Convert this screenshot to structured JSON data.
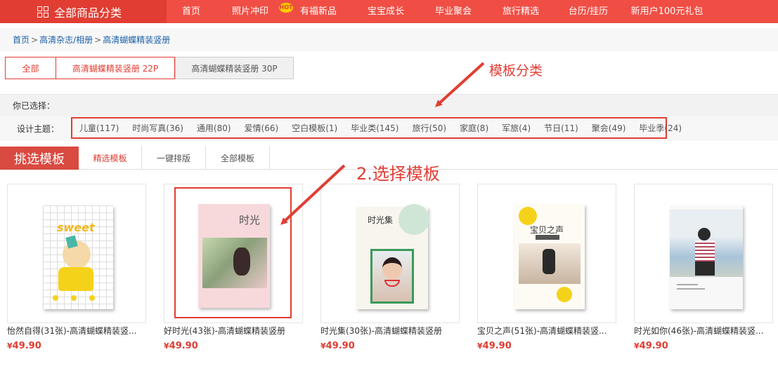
{
  "nav": {
    "category_label": "全部商品分类",
    "items": [
      "首页",
      "照片冲印",
      "有福新品",
      "宝宝成长",
      "毕业聚会",
      "旅行精选",
      "台历/挂历",
      "新用户100元礼包"
    ],
    "hot_badge": "HOT"
  },
  "breadcrumb": [
    "首页",
    "高清杂志/相册",
    "高清蝴蝶精装竖册"
  ],
  "album_tabs": [
    "全部",
    "高清蝴蝶精装竖册 22P",
    "高清蝴蝶精装竖册 30P"
  ],
  "selection": {
    "chosen_label": "你已选择：",
    "theme_label": "设计主题：",
    "themes": [
      "儿童(117)",
      "时尚写真(36)",
      "通用(80)",
      "爱情(66)",
      "空白模板(1)",
      "毕业类(145)",
      "旅行(50)",
      "家庭(8)",
      "军旅(4)",
      "节日(11)",
      "聚会(49)",
      "毕业季(24)"
    ]
  },
  "annotations": {
    "category_note": "模板分类",
    "select_note": "2.选择模板"
  },
  "template_tabs": {
    "header": "挑选模板",
    "tabs": [
      "精选模板",
      "一键排版",
      "全部模板"
    ]
  },
  "products": [
    {
      "title": "怡然自得(31张)-高清蝴蝶精装竖...",
      "price": "49.90",
      "cover_text": "sweet"
    },
    {
      "title": "好时光(43张)-高清蝴蝶精装竖册",
      "price": "49.90",
      "cover_text": "时光"
    },
    {
      "title": "时光集(30张)-高清蝴蝶精装竖册",
      "price": "49.90",
      "cover_text": "时光集"
    },
    {
      "title": "宝贝之声(51张)-高清蝴蝶精装竖...",
      "price": "49.90",
      "cover_text": "宝贝之声"
    },
    {
      "title": "时光如你(46张)-高清蝴蝶精装竖...",
      "price": "49.90",
      "cover_text": ""
    }
  ],
  "currency": "¥",
  "colors": {
    "brand": "#f04e44",
    "accent": "#e13d33"
  }
}
